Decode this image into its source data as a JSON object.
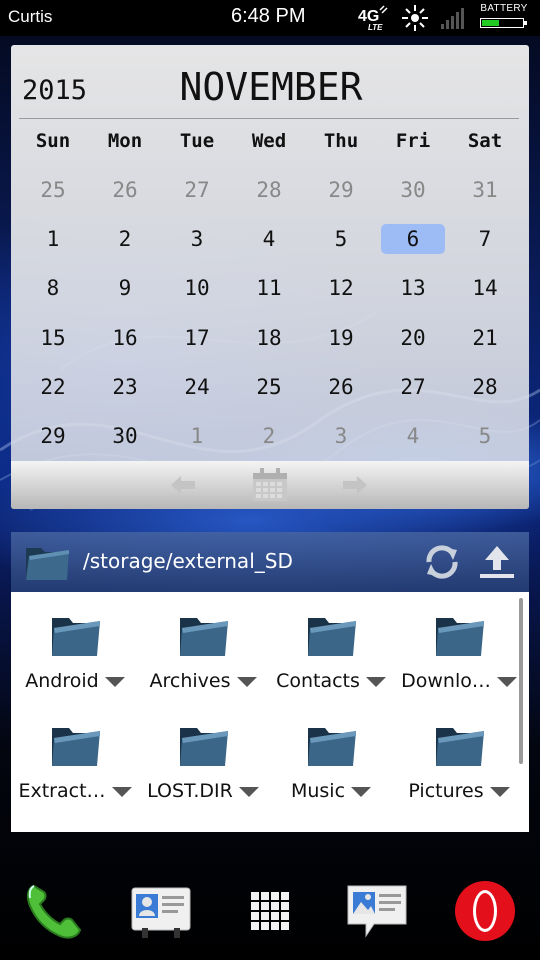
{
  "status_bar": {
    "carrier": "Curtis",
    "time": "6:48 PM",
    "network_badge": "4G LTE",
    "battery_label": "BATTERY",
    "battery_level_pct": 40,
    "icons": [
      "4g-lte-icon",
      "sync-icon",
      "signal-icon",
      "battery-icon"
    ]
  },
  "calendar": {
    "year": "2015",
    "month": "NOVEMBER",
    "weekdays": [
      "Sun",
      "Mon",
      "Tue",
      "Wed",
      "Thu",
      "Fri",
      "Sat"
    ],
    "weeks": [
      [
        {
          "d": "25",
          "other": true
        },
        {
          "d": "26",
          "other": true
        },
        {
          "d": "27",
          "other": true
        },
        {
          "d": "28",
          "other": true
        },
        {
          "d": "29",
          "other": true
        },
        {
          "d": "30",
          "other": true
        },
        {
          "d": "31",
          "other": true
        }
      ],
      [
        {
          "d": "1"
        },
        {
          "d": "2"
        },
        {
          "d": "3"
        },
        {
          "d": "4"
        },
        {
          "d": "5"
        },
        {
          "d": "6",
          "today": true
        },
        {
          "d": "7"
        }
      ],
      [
        {
          "d": "8"
        },
        {
          "d": "9"
        },
        {
          "d": "10"
        },
        {
          "d": "11"
        },
        {
          "d": "12"
        },
        {
          "d": "13"
        },
        {
          "d": "14"
        }
      ],
      [
        {
          "d": "15"
        },
        {
          "d": "16"
        },
        {
          "d": "17"
        },
        {
          "d": "18"
        },
        {
          "d": "19"
        },
        {
          "d": "20"
        },
        {
          "d": "21"
        }
      ],
      [
        {
          "d": "22"
        },
        {
          "d": "23"
        },
        {
          "d": "24"
        },
        {
          "d": "25"
        },
        {
          "d": "26"
        },
        {
          "d": "27"
        },
        {
          "d": "28"
        }
      ],
      [
        {
          "d": "29"
        },
        {
          "d": "30"
        },
        {
          "d": "1",
          "other": true
        },
        {
          "d": "2",
          "other": true
        },
        {
          "d": "3",
          "other": true
        },
        {
          "d": "4",
          "other": true
        },
        {
          "d": "5",
          "other": true
        }
      ]
    ],
    "toolbar_icons": [
      "prev-month-arrow-icon",
      "calendar-today-icon",
      "next-month-arrow-icon"
    ],
    "today_highlight_color": "#9dbcf5"
  },
  "file_manager": {
    "path": "/storage/external_SD",
    "header_icons": [
      "folder-icon",
      "refresh-icon",
      "upload-icon"
    ],
    "items": [
      {
        "label": "Android"
      },
      {
        "label": "Archives"
      },
      {
        "label": "Contacts"
      },
      {
        "label": "Downlo…"
      },
      {
        "label": "Extract…"
      },
      {
        "label": "LOST.DIR"
      },
      {
        "label": "Music"
      },
      {
        "label": "Pictures"
      }
    ]
  },
  "dock": {
    "icons": [
      "phone-icon",
      "contacts-icon",
      "app-drawer-icon",
      "messages-icon",
      "opera-browser-icon"
    ]
  }
}
